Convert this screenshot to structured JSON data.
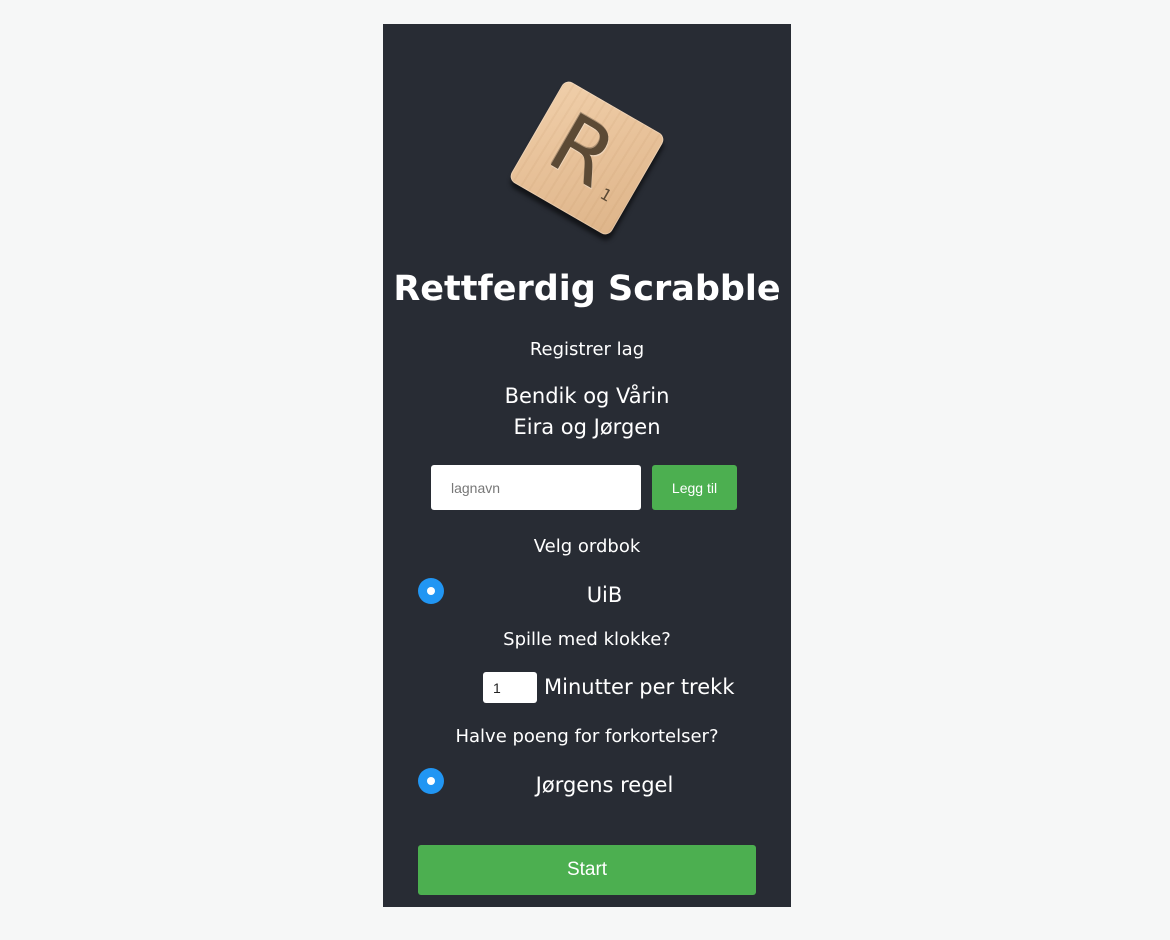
{
  "logo": {
    "letter": "R",
    "points": "1"
  },
  "app": {
    "title": "Rettferdig Scrabble"
  },
  "teams": {
    "heading": "Registrer lag",
    "list": [
      "Bendik og Vårin",
      "Eira og Jørgen"
    ],
    "input_placeholder": "lagnavn",
    "add_label": "Legg til"
  },
  "dictionary": {
    "heading": "Velg ordbok",
    "option_label": "UiB",
    "selected": true
  },
  "clock": {
    "heading": "Spille med klokke?",
    "minutes_value": "1",
    "minutes_label": "Minutter per trekk"
  },
  "abbreviations": {
    "heading": "Halve poeng for forkortelser?",
    "option_label": "Jørgens regel",
    "selected": true
  },
  "actions": {
    "start_label": "Start"
  },
  "colors": {
    "panel_bg": "#282c34",
    "accent_green": "#4caf50",
    "radio_blue": "#2196f3",
    "page_bg": "#f6f7f7"
  }
}
